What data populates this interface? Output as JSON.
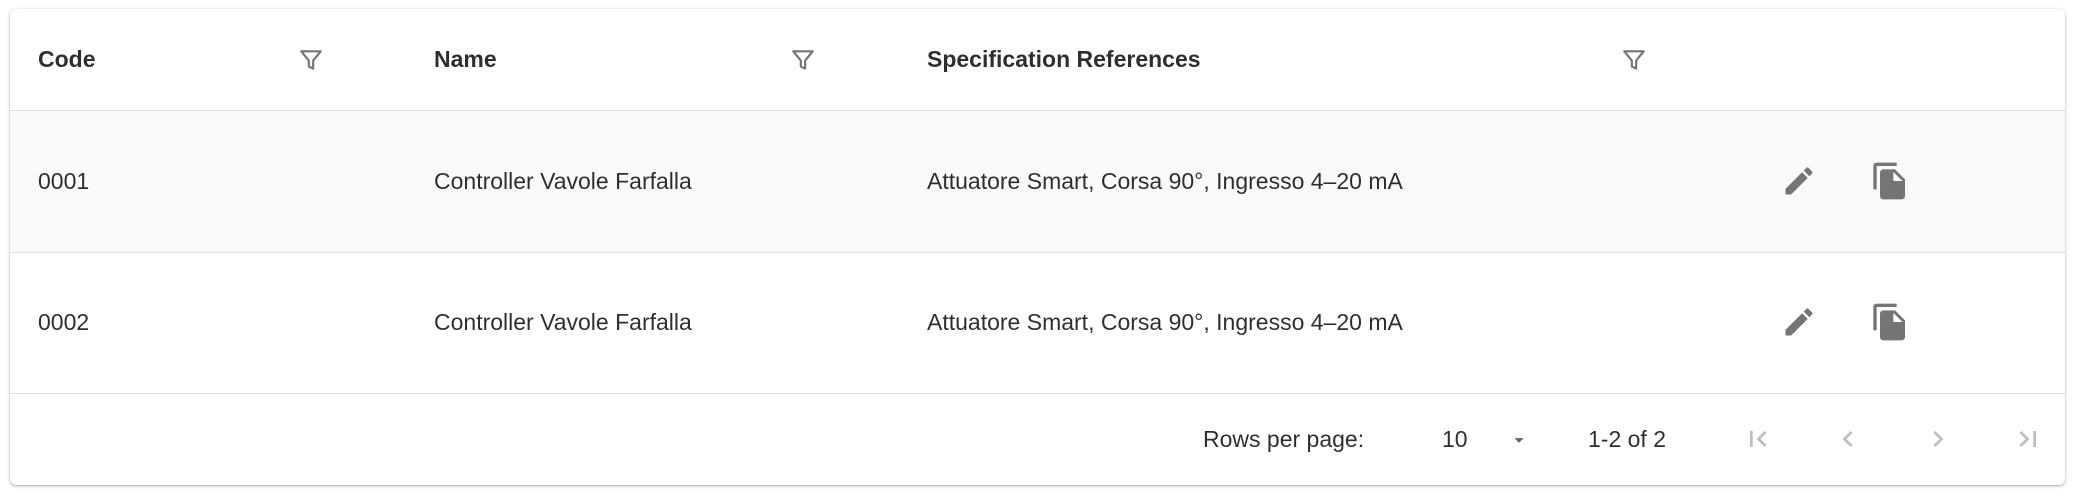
{
  "table": {
    "columns": [
      {
        "label": "Code"
      },
      {
        "label": "Name"
      },
      {
        "label": "Specification References"
      }
    ],
    "rows": [
      {
        "code": "0001",
        "name": "Controller Vavole Farfalla",
        "spec": "Attuatore Smart, Corsa 90°, Ingresso 4–20 mA"
      },
      {
        "code": "0002",
        "name": "Controller Vavole Farfalla",
        "spec": "Attuatore Smart, Corsa 90°, Ingresso 4–20 mA"
      }
    ],
    "row_actions": [
      "pencil-icon",
      "copy-icon"
    ]
  },
  "pagination": {
    "rows_per_page_label": "Rows per page:",
    "rows_per_page_value": "10",
    "range_text": "1-2 of 2",
    "buttons": [
      "first-page-icon",
      "previous-page-icon",
      "next-page-icon",
      "last-page-icon"
    ]
  },
  "colors": {
    "icon": "#757575",
    "icon_disabled": "#bdbdbd",
    "row_alt_bg": "#fafafa",
    "divider": "#e0e0e0"
  }
}
